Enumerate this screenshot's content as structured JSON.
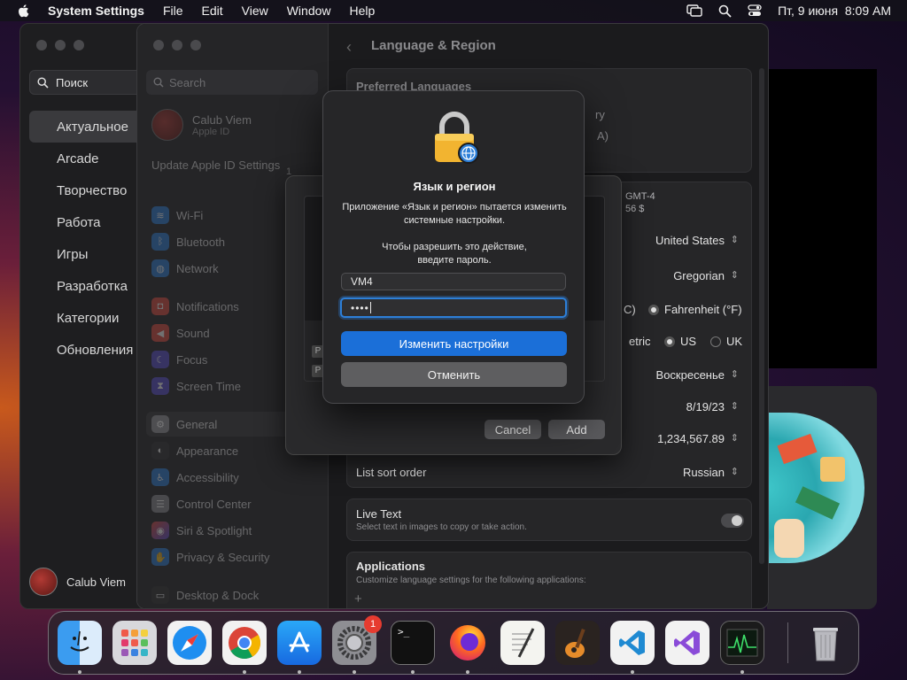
{
  "menubar": {
    "app": "System Settings",
    "items": [
      "File",
      "Edit",
      "View",
      "Window",
      "Help"
    ],
    "datetime": "Пт, 9 июня  8:09 AM"
  },
  "store": {
    "search": "Поиск",
    "nav": [
      "Актуальное",
      "Arcade",
      "Творчество",
      "Работа",
      "Игры",
      "Разработка",
      "Категории",
      "Обновления"
    ],
    "user": "Calub Viem"
  },
  "settings": {
    "search_placeholder": "Search",
    "profile_name": "Calub Viem",
    "profile_sub": "Apple ID",
    "update": "Update Apple ID Settings",
    "update_badge": "1",
    "sidebar": [
      "Wi-Fi",
      "Bluetooth",
      "Network",
      "Notifications",
      "Sound",
      "Focus",
      "Screen Time",
      "General",
      "Appearance",
      "Accessibility",
      "Control Center",
      "Siri & Spotlight",
      "Privacy & Security",
      "Desktop & Dock"
    ],
    "page_title": "Language & Region",
    "preferred_languages": "Preferred Languages",
    "lang_frag1": "ry",
    "lang_frag2": "A)",
    "tz_frag": "GMT-4",
    "price_frag": "56 $",
    "region": "United States",
    "calendar": "Gregorian",
    "temp_c_frag": "C)",
    "temp_f": "Fahrenheit (°F)",
    "measure_frag": "etric",
    "measure_us": "US",
    "measure_uk": "UK",
    "first_day": "Воскресенье",
    "date_format": "8/19/23",
    "number_format": "1,234,567.89",
    "list_sort_label": "List sort order",
    "list_sort_value": "Russian",
    "live_text_label": "Live Text",
    "live_text_sub": "Select text in images to copy or take action.",
    "apps_label": "Applications",
    "apps_sub": "Customize language settings for the following applications:",
    "plus": "+"
  },
  "sheet": {
    "cancel": "Cancel",
    "add": "Add",
    "row_glyph": "P"
  },
  "auth": {
    "title": "Язык и регион",
    "message1": "Приложение «Язык и регион» пытается изменить системные настройки.",
    "message2": "Чтобы разрешить это действие, введите пароль.",
    "username": "VM4",
    "password_mask": "••••",
    "confirm": "Изменить настройки",
    "cancel": "Отменить"
  },
  "dock": {
    "badge": "1",
    "terminal_prompt": ">_"
  },
  "colors": {
    "accent": "#1b6fd8",
    "focus_ring": "#2d7fd8",
    "badge": "#e63b30"
  }
}
